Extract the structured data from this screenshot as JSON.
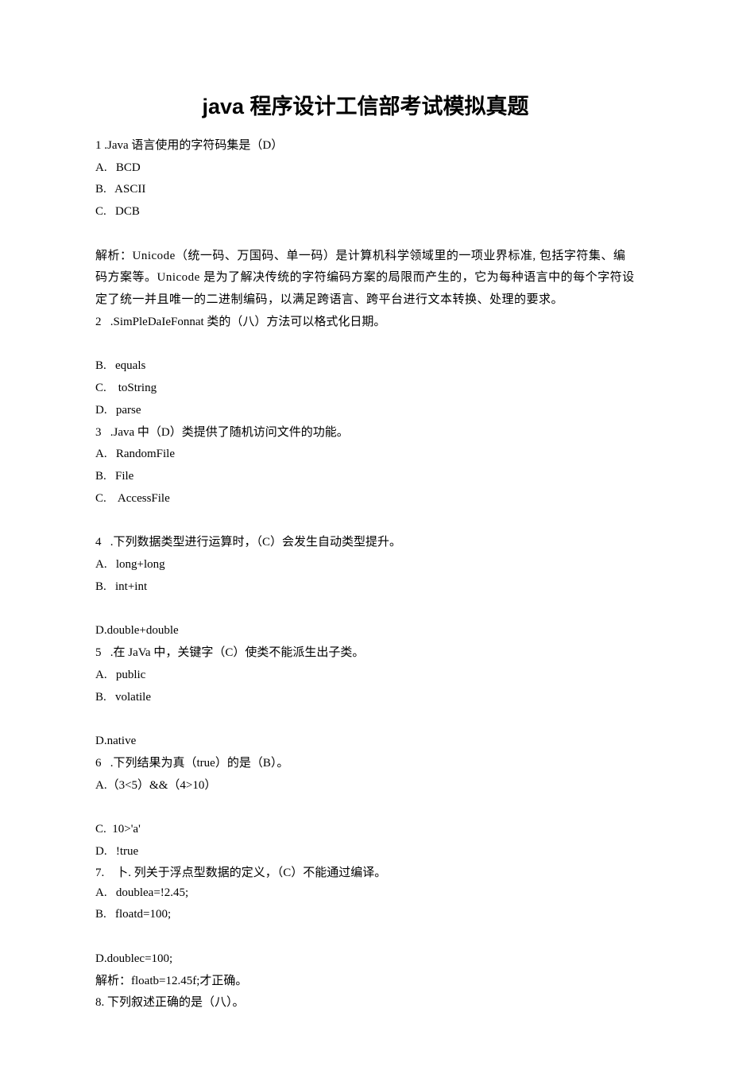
{
  "title": "java 程序设计工信部考试模拟真题",
  "lines": {
    "l1": "1 .Java 语言使用的字符码集是（D）",
    "l2": "A.   BCD",
    "l3": "B.   ASCII",
    "l4": "C.   DCB",
    "l5": "解析：Unicode（统一码、万国码、单一码）是计算机科学领域里的一项业界标准, 包括字符集、编码方案等。Unicode 是为了解决传统的字符编码方案的局限而产生的，它为每种语言中的每个字符设定了统一并且唯一的二进制编码，以满足跨语言、跨平台进行文本转换、处理的要求。",
    "l6": "2   .SimPleDaIeFonnat 类的（八）方法可以格式化日期。",
    "l7": "B.   equals",
    "l8": "C.    toString",
    "l9": "D.   parse",
    "l10": "3   .Java 中（D）类提供了随机访问文件的功能。",
    "l11": "A.   RandomFile",
    "l12": "B.   File",
    "l13": "C.    AccessFile",
    "l14": "4   .下列数据类型进行运算时，（C）会发生自动类型提升。",
    "l15": "A.   long+long",
    "l16": "B.   int+int",
    "l17": "D.double+double",
    "l18": "5   .在 JaVa 中，关键字（C）使类不能派生出子类。",
    "l19": "A.   public",
    "l20": "B.   volatile",
    "l21": "D.native",
    "l22": "6   .下列结果为真（true）的是（B）。",
    "l23": "A.（3<5）&&（4>10）",
    "l24": "C.  10>'a'",
    "l25": "D.   !true",
    "l26": "7.    卜. 列关于浮点型数据的定义，（C）不能通过编译。",
    "l27": "A.   doublea=!2.45;",
    "l28": "B.   floatd=100;",
    "l29": "D.doublec=100;",
    "l30": "解析：floatb=12.45f;才正确。",
    "l31": "8. 下列叙述正确的是（八）。"
  }
}
